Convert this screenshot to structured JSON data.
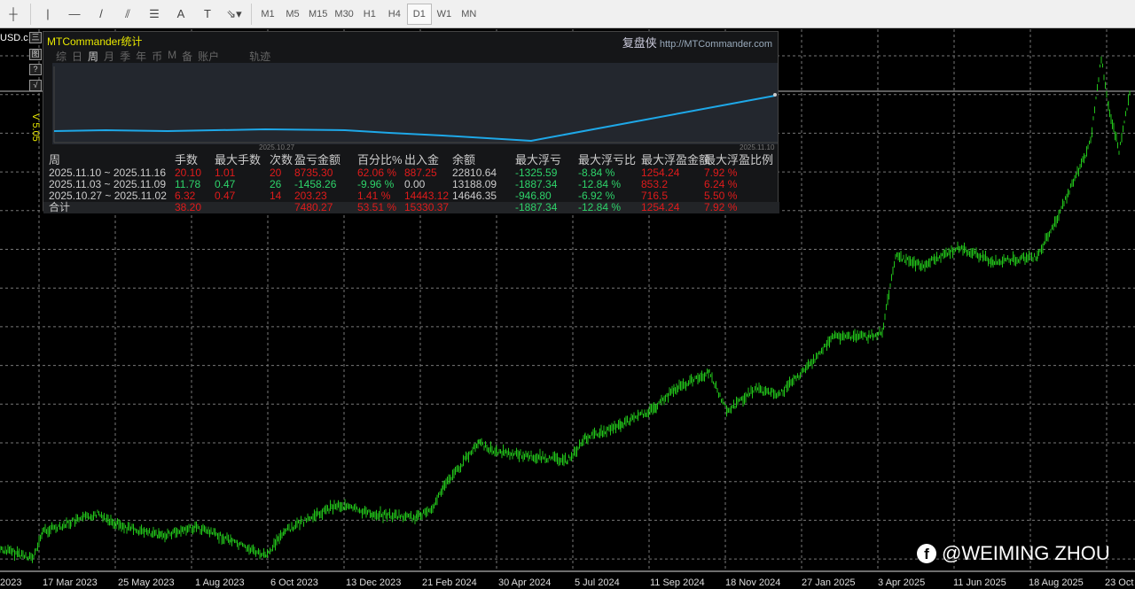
{
  "toolbar": {
    "tools": [
      "crosshair",
      "vertical-line",
      "horizontal-line",
      "trend-line",
      "fibonacci",
      "fibo-lines",
      "A",
      "T",
      "arrows"
    ],
    "timeframes": [
      "M1",
      "M5",
      "M15",
      "M30",
      "H1",
      "H4",
      "D1",
      "W1",
      "MN"
    ],
    "active": "D1"
  },
  "chart": {
    "symbol": "USD.c,",
    "version": "V 5.05",
    "xlabels": [
      "2023",
      "17 Mar 2023",
      "25 May 2023",
      "1 Aug 2023",
      "6 Oct 2023",
      "13 Dec 2023",
      "21 Feb 2024",
      "30 Apr 2024",
      "5 Jul 2024",
      "11 Sep 2024",
      "18 Nov 2024",
      "27 Jan 2025",
      "3 Apr 2025",
      "11 Jun 2025",
      "18 Aug 2025",
      "23 Oct"
    ],
    "line_color": "#22c41a"
  },
  "side_buttons": [
    "三",
    "图",
    "?",
    "√"
  ],
  "panel": {
    "title": "MTCommander统计",
    "brand": "复盘侠",
    "url": "http://MTCommander.com",
    "tabs": [
      "综",
      "日",
      "周",
      "月",
      "季",
      "年",
      "币",
      "M",
      "备",
      "账户",
      "轨迹"
    ],
    "active_tab": "周",
    "dates": [
      "2025.10.27",
      "2025.11.10"
    ],
    "headers": [
      "周",
      "手数",
      "最大手数",
      "次数",
      "盈亏金额",
      "百分比%",
      "出入金",
      "余额",
      "最大浮亏",
      "最大浮亏比",
      "最大浮盈金额",
      "最大浮盈比例"
    ],
    "rows": [
      {
        "cells": [
          "2025.11.10 ~ 2025.11.16",
          "20.10",
          "1.01",
          "20",
          "8735.30",
          "62.06 %",
          "887.25",
          "22810.64",
          "-1325.59",
          "-8.84 %",
          "1254.24",
          "7.92 %"
        ],
        "colors": [
          "w",
          "r",
          "r",
          "r",
          "r",
          "r",
          "r",
          "w",
          "g",
          "g",
          "r",
          "r"
        ]
      },
      {
        "cells": [
          "2025.11.03 ~ 2025.11.09",
          "11.78",
          "0.47",
          "26",
          "-1458.26",
          "-9.96 %",
          "0.00",
          "13188.09",
          "-1887.34",
          "-12.84 %",
          "853.2",
          "6.24 %"
        ],
        "colors": [
          "w",
          "g",
          "g",
          "g",
          "g",
          "g",
          "w",
          "w",
          "g",
          "g",
          "r",
          "r"
        ]
      },
      {
        "cells": [
          "2025.10.27 ~ 2025.11.02",
          "6.32",
          "0.47",
          "14",
          "203.23",
          "1.41 %",
          "14443.12",
          "14646.35",
          "-946.80",
          "-6.92 %",
          "716.5",
          "5.50 %"
        ],
        "colors": [
          "w",
          "r",
          "r",
          "r",
          "r",
          "r",
          "r",
          "w",
          "g",
          "g",
          "r",
          "r"
        ]
      },
      {
        "cells": [
          "合计",
          "38.20",
          "",
          "",
          "7480.27",
          "53.51 %",
          "15330.37",
          "",
          "-1887.34",
          "-12.84 %",
          "1254.24",
          "7.92 %"
        ],
        "colors": [
          "w",
          "r",
          "r",
          "r",
          "r",
          "r",
          "r",
          "w",
          "g",
          "g",
          "r",
          "r"
        ]
      }
    ]
  },
  "watermark": {
    "text": "@WEIMING ZHOU",
    "icon": "facebook-icon"
  }
}
